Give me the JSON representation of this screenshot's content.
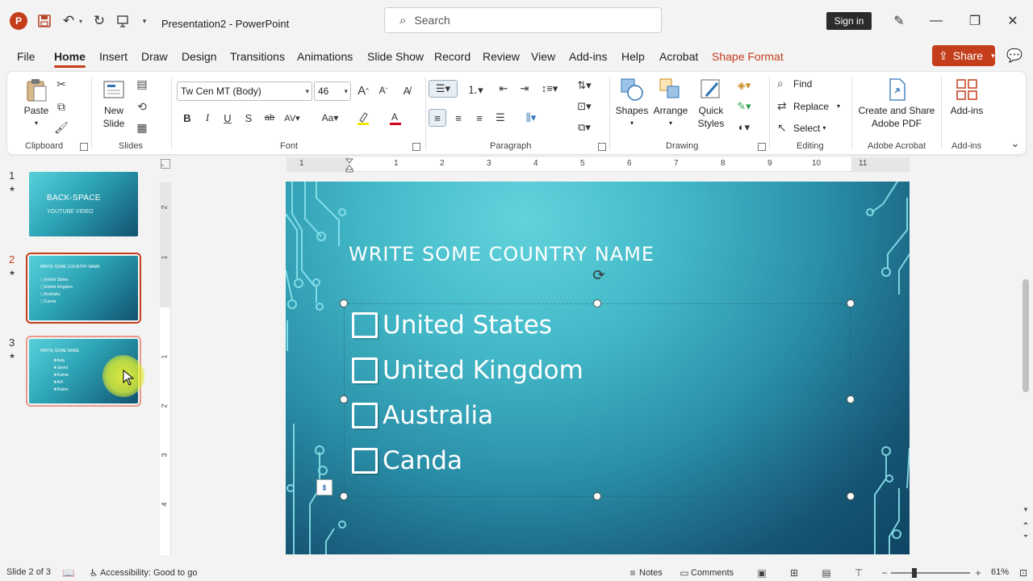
{
  "titlebar": {
    "app_letter": "P",
    "doc_title": "Presentation2  -  PowerPoint",
    "search_placeholder": "Search",
    "signin": "Sign in"
  },
  "tabs": [
    "File",
    "Home",
    "Insert",
    "Draw",
    "Design",
    "Transitions",
    "Animations",
    "Slide Show",
    "Record",
    "Review",
    "View",
    "Add-ins",
    "Help",
    "Acrobat",
    "Shape Format"
  ],
  "active_tab": "Home",
  "share": "Share",
  "ribbon": {
    "clipboard": {
      "label": "Clipboard",
      "paste": "Paste"
    },
    "slides": {
      "label": "Slides",
      "new_slide_1": "New",
      "new_slide_2": "Slide"
    },
    "font": {
      "label": "Font",
      "family": "Tw Cen MT (Body)",
      "size": "46",
      "case": "Aa"
    },
    "paragraph": {
      "label": "Paragraph"
    },
    "drawing": {
      "label": "Drawing",
      "shapes": "Shapes",
      "arrange": "Arrange",
      "quick_1": "Quick",
      "quick_2": "Styles"
    },
    "editing": {
      "label": "Editing",
      "find": "Find",
      "replace": "Replace",
      "select": "Select"
    },
    "acrobat": {
      "label": "Adobe Acrobat",
      "btn_1": "Create and Share",
      "btn_2": "Adobe PDF"
    },
    "addins": {
      "label": "Add-ins",
      "btn": "Add-ins"
    }
  },
  "thumbnails": [
    {
      "num": "1",
      "title": "BACK-SPACE",
      "subtitle": "YOUTUBE VIDEO"
    },
    {
      "num": "2",
      "title": "WRITE SOME COUNTRY NAME",
      "items": [
        "United States",
        "United Kingdom",
        "Australia",
        "Canda"
      ]
    },
    {
      "num": "3",
      "title": "WRITE SOME NAME",
      "items": [
        "Asia",
        "Janed",
        "Kamal",
        "Arif",
        "Rakim"
      ]
    }
  ],
  "ruler_h": [
    "1",
    "1",
    "2",
    "3",
    "4",
    "5",
    "6",
    "7",
    "8",
    "9",
    "10",
    "11"
  ],
  "ruler_v": [
    "2",
    "1",
    "1",
    "2",
    "3",
    "4"
  ],
  "slide": {
    "title": "WRITE SOME COUNTRY NAME",
    "items": [
      "United States",
      "United Kingdom",
      "Australia",
      "Canda"
    ]
  },
  "status": {
    "slide_info": "Slide 2 of 3",
    "accessibility": "Accessibility: Good to go",
    "notes": "Notes",
    "comments": "Comments",
    "zoom": "61%"
  },
  "colors": {
    "accent": "#c43e1c",
    "slide_light": "#62d3dc",
    "slide_dark": "#0f4464"
  }
}
